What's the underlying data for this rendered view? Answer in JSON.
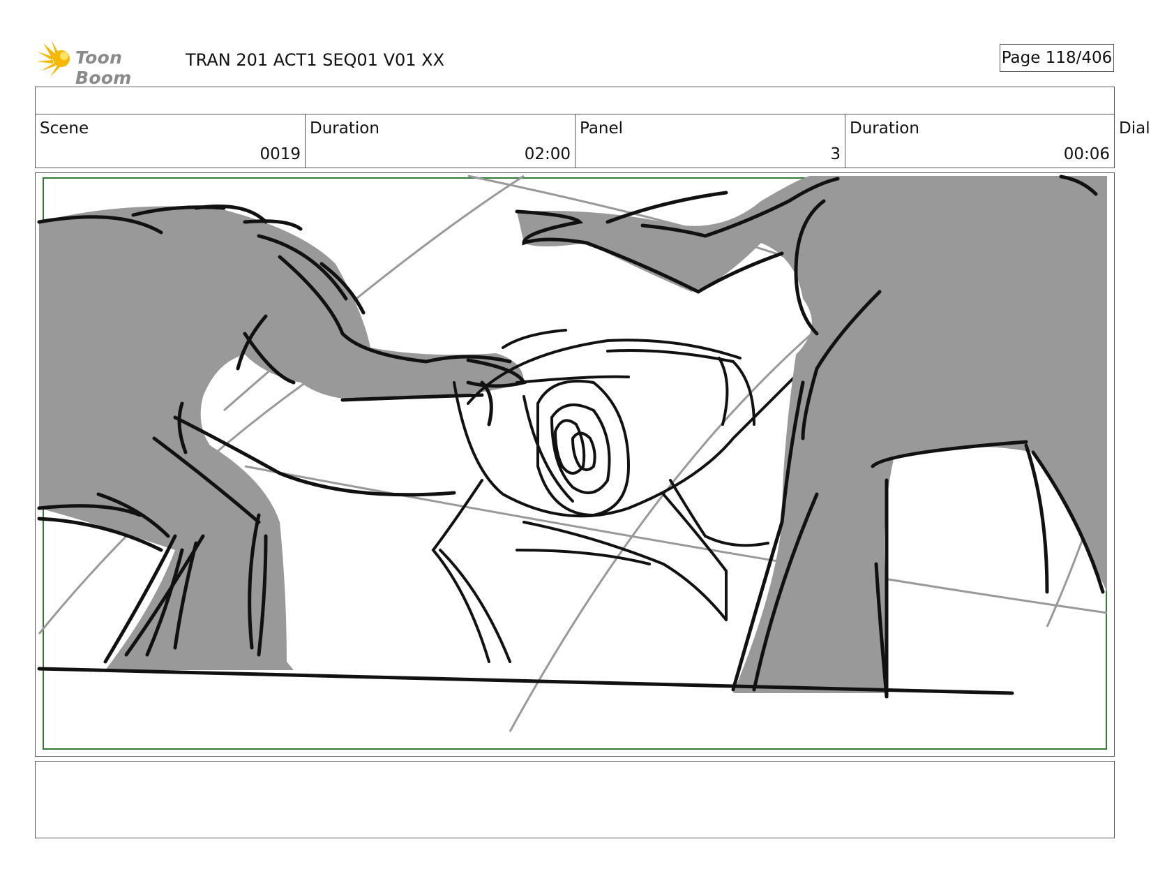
{
  "header": {
    "logo_text": "Toon Boom",
    "project_title": "TRAN 201 ACT1 SEQ01 V01 XX",
    "page_label": "Page 118/406"
  },
  "info": {
    "scene_label": "Scene",
    "scene_value": "0019",
    "scene_duration_label": "Duration",
    "scene_duration_value": "02:00",
    "panel_label": "Panel",
    "panel_value": "3",
    "panel_duration_label": "Duration",
    "panel_duration_value": "00:06",
    "dialog_label": "Dialc"
  },
  "panel": {
    "safe_frame_color": "#2e7d32",
    "fill_color": "#999999",
    "guide_color": "#999999",
    "ink_color": "#111111"
  }
}
